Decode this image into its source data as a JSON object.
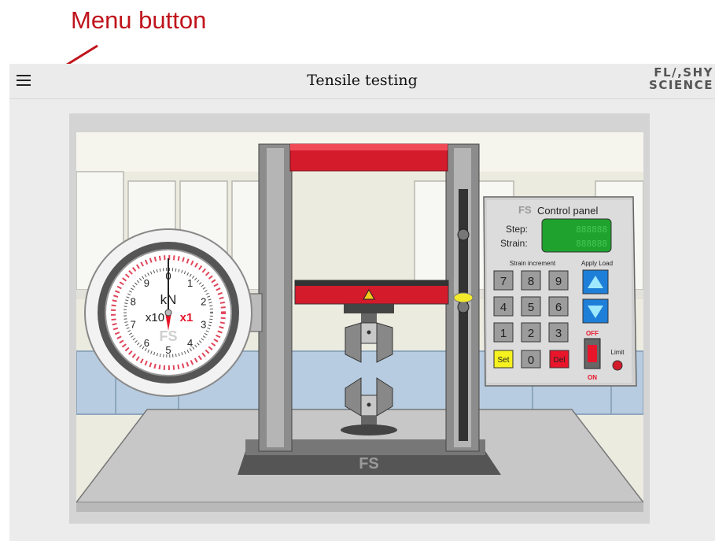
{
  "annotation": {
    "text": "Menu button",
    "color": "#c0141c"
  },
  "header": {
    "title": "Tensile testing",
    "logo_line1": "FL/,SHY",
    "logo_line2": "SCIENCE"
  },
  "gauge": {
    "unit": "kN",
    "multiplier_left": "x10",
    "multiplier_right": "x1",
    "brand": "FS",
    "dial_numbers": [
      "0",
      "1",
      "2",
      "3",
      "4",
      "5",
      "6",
      "7",
      "8",
      "9"
    ]
  },
  "machine": {
    "brand": "FS"
  },
  "control_panel": {
    "brand": "FS",
    "title": "Control panel",
    "step_label": "Step:",
    "strain_label": "Strain:",
    "step_value": "888888",
    "strain_value": "888888",
    "strain_increment_label": "Strain increment",
    "apply_load_label": "Apply Load",
    "keys": [
      "7",
      "8",
      "9",
      "4",
      "5",
      "6",
      "1",
      "2",
      "3"
    ],
    "set_label": "Set",
    "zero_label": "0",
    "del_label": "Del",
    "off_label": "OFF",
    "on_label": "ON",
    "limit_label": "Limit"
  },
  "colors": {
    "accent_red": "#e8152b",
    "display_green": "#1fa32e",
    "arrow_blue": "#1e7fd8"
  }
}
